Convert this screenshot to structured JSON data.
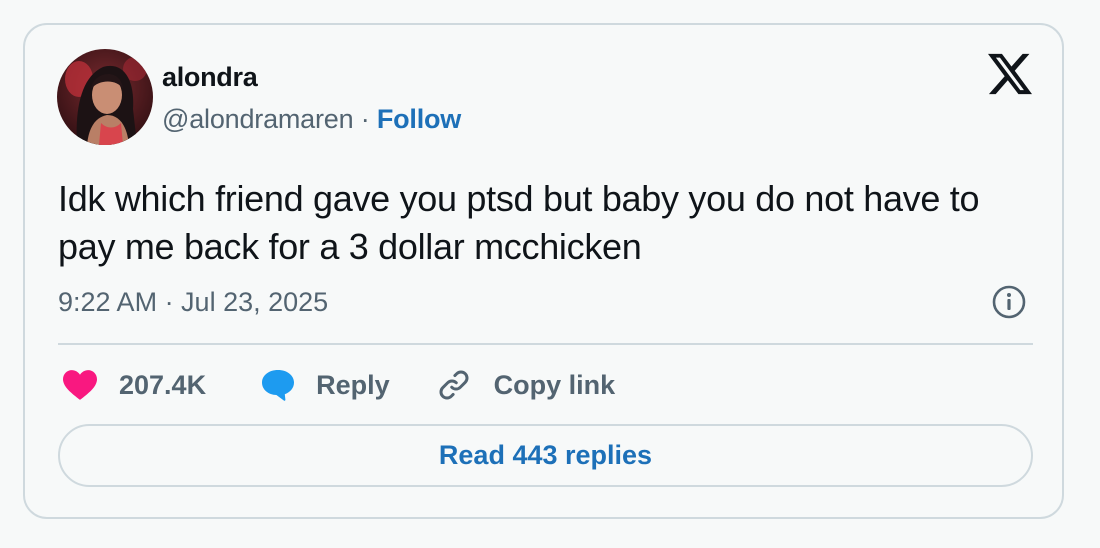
{
  "user": {
    "display_name": "alondra",
    "handle": "@alondramaren",
    "separator": "·",
    "follow_label": "Follow",
    "avatar_icon": "profile-photo"
  },
  "platform": {
    "logo_icon": "x-logo-icon"
  },
  "tweet": {
    "text": "Idk which friend gave you ptsd but baby you do not have to pay me back for a 3 dollar mcchicken",
    "timestamp": "9:22 AM · Jul 23, 2025"
  },
  "actions": {
    "likes_count": "207.4K",
    "reply_label": "Reply",
    "copy_link_label": "Copy link"
  },
  "read_replies_label": "Read 443 replies",
  "colors": {
    "background": "#f7f9f9",
    "border": "#cfd9de",
    "text_primary": "#0f1419",
    "text_secondary": "#536471",
    "link_blue": "#1d70b8",
    "heart_pink": "#f91880",
    "reply_blue": "#1d9bf0"
  },
  "icons": {
    "like": "heart-icon",
    "reply": "speech-bubble-icon",
    "copy_link": "link-icon",
    "info": "info-icon"
  }
}
